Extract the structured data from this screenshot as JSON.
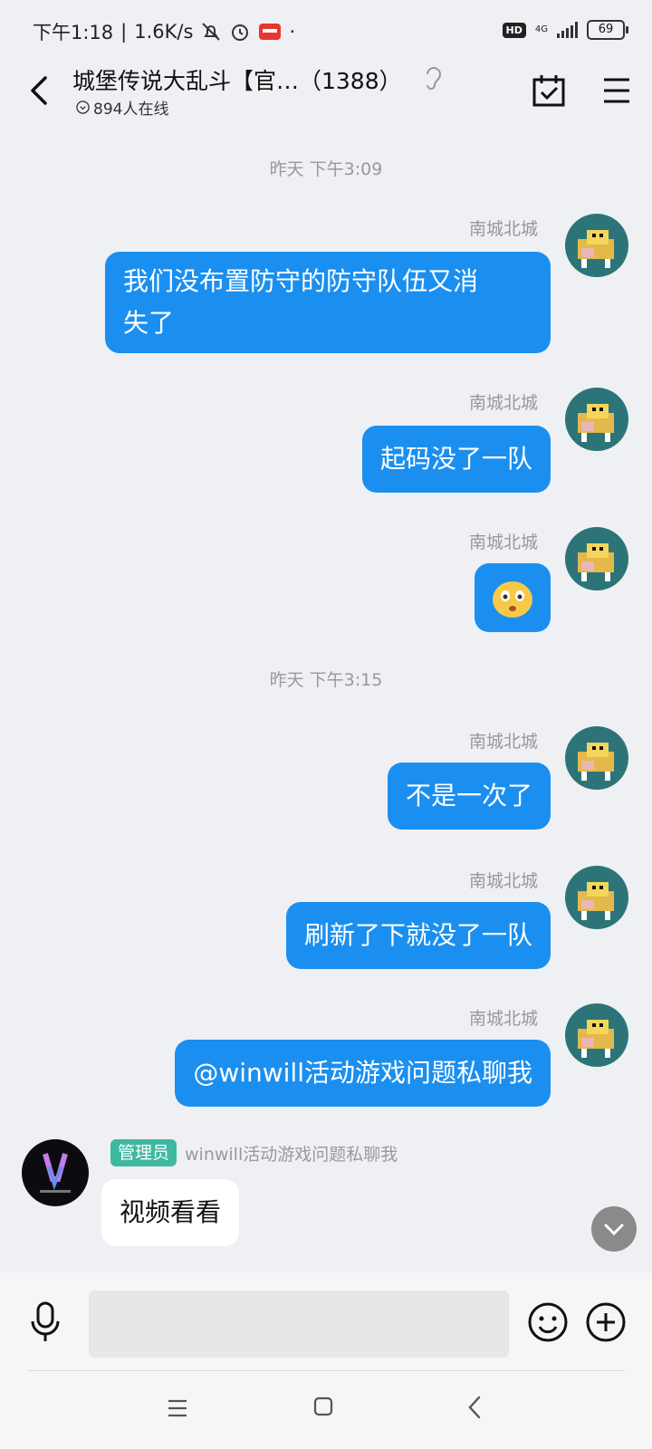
{
  "status_bar": {
    "time": "下午1:18",
    "speed": "1.6K/s",
    "hd": "HD",
    "network": "4G",
    "battery": "69"
  },
  "header": {
    "title": "城堡传说大乱斗【官…（1388）",
    "online": "894人在线"
  },
  "timestamps": [
    "昨天 下午3:09",
    "昨天 下午3:15"
  ],
  "messages": [
    {
      "sender": "南城北城",
      "line1": "我们没布置防守的防守队伍又消",
      "line2": "失了"
    },
    {
      "sender": "南城北城",
      "text": "起码没了一队"
    },
    {
      "sender": "南城北城",
      "emoji": "😮"
    },
    {
      "sender": "南城北城",
      "text": "不是一次了"
    },
    {
      "sender": "南城北城",
      "text": "刷新了下就没了一队"
    },
    {
      "sender": "南城北城",
      "text": "@winwill活动游戏问题私聊我"
    }
  ],
  "admin_message": {
    "badge": "管理员",
    "sender": "winwill活动游戏问题私聊我",
    "text": "视频看看"
  },
  "input": {
    "placeholder": ""
  },
  "colors": {
    "bubble_out": "#1b8ff0",
    "bubble_in": "#ffffff",
    "admin_badge": "#3fb8a0",
    "avatar_bg": "#2d7478"
  }
}
